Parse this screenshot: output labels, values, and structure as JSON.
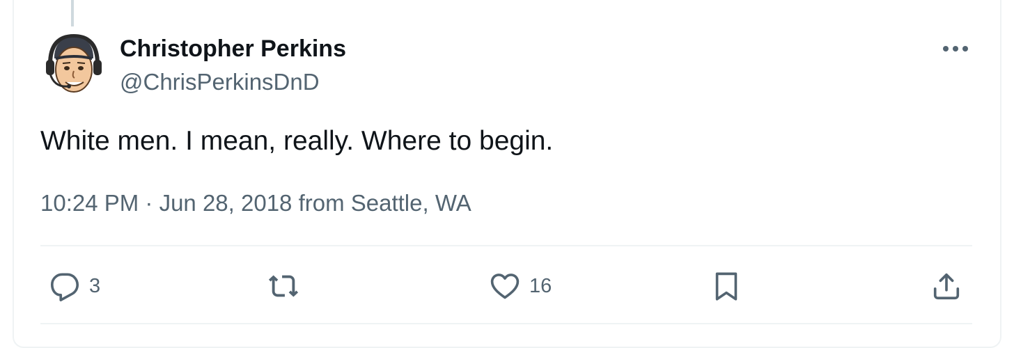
{
  "tweet": {
    "author_name": "Christopher Perkins",
    "author_handle": "@ChrisPerkinsDnD",
    "text": "White men. I mean, really. Where to begin.",
    "meta": "10:24 PM · Jun 28, 2018 from Seattle, WA"
  },
  "actions": {
    "reply": {
      "icon": "reply-icon",
      "count": "3"
    },
    "retweet": {
      "icon": "retweet-icon"
    },
    "like": {
      "icon": "heart-icon",
      "count": "16"
    },
    "bookmark": {
      "icon": "bookmark-icon"
    },
    "share": {
      "icon": "share-icon"
    }
  },
  "colors": {
    "text_primary": "#0f1419",
    "text_secondary": "#536471",
    "divider": "#eff3f4"
  }
}
